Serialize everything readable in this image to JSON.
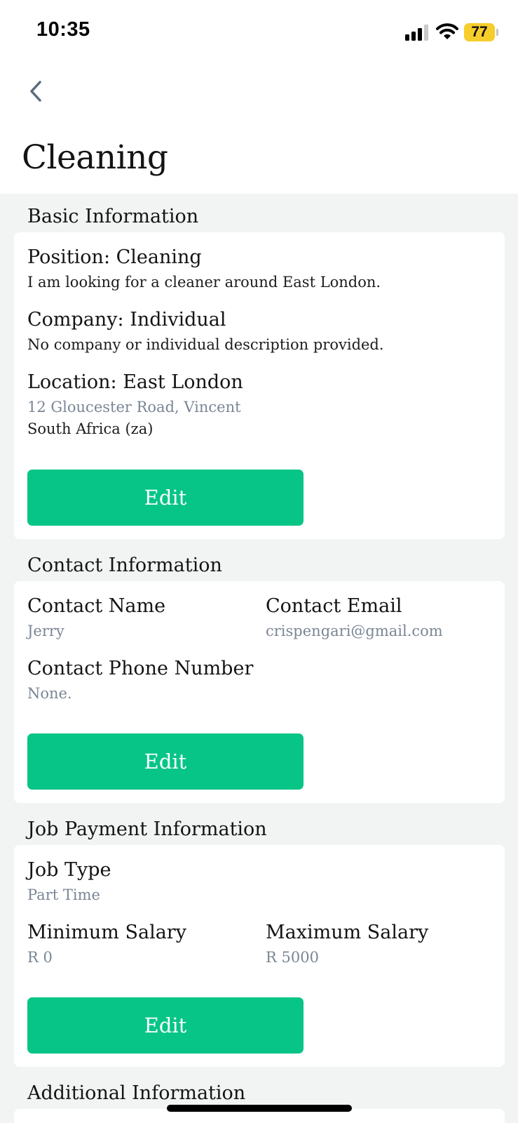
{
  "status_bar": {
    "time": "10:35",
    "battery": "77"
  },
  "header": {
    "title": "Cleaning"
  },
  "basic": {
    "section_title": "Basic Information",
    "position_label": "Position: Cleaning",
    "position_desc": "I am looking for a cleaner around East London.",
    "company_label": "Company: Individual",
    "company_desc": "No company or individual description provided.",
    "location_label": "Location: East London",
    "address_line1": "12 Gloucester Road, Vincent",
    "address_line2": "South Africa (za)",
    "edit_label": "Edit"
  },
  "contact": {
    "section_title": "Contact Information",
    "name_label": "Contact Name",
    "name_value": "Jerry",
    "email_label": "Contact Email",
    "email_value": "crispengari@gmail.com",
    "phone_label": "Contact Phone Number",
    "phone_value": "None.",
    "edit_label": "Edit"
  },
  "payment": {
    "section_title": "Job Payment Information",
    "type_label": "Job Type",
    "type_value": "Part Time",
    "min_label": "Minimum Salary",
    "min_value": "R 0",
    "max_label": "Maximum Salary",
    "max_value": "R 5000",
    "edit_label": "Edit"
  },
  "additional": {
    "section_title": "Additional Information"
  },
  "colors": {
    "accent": "#06c586",
    "muted_text": "#7a8696",
    "background": "#f2f3f3"
  }
}
